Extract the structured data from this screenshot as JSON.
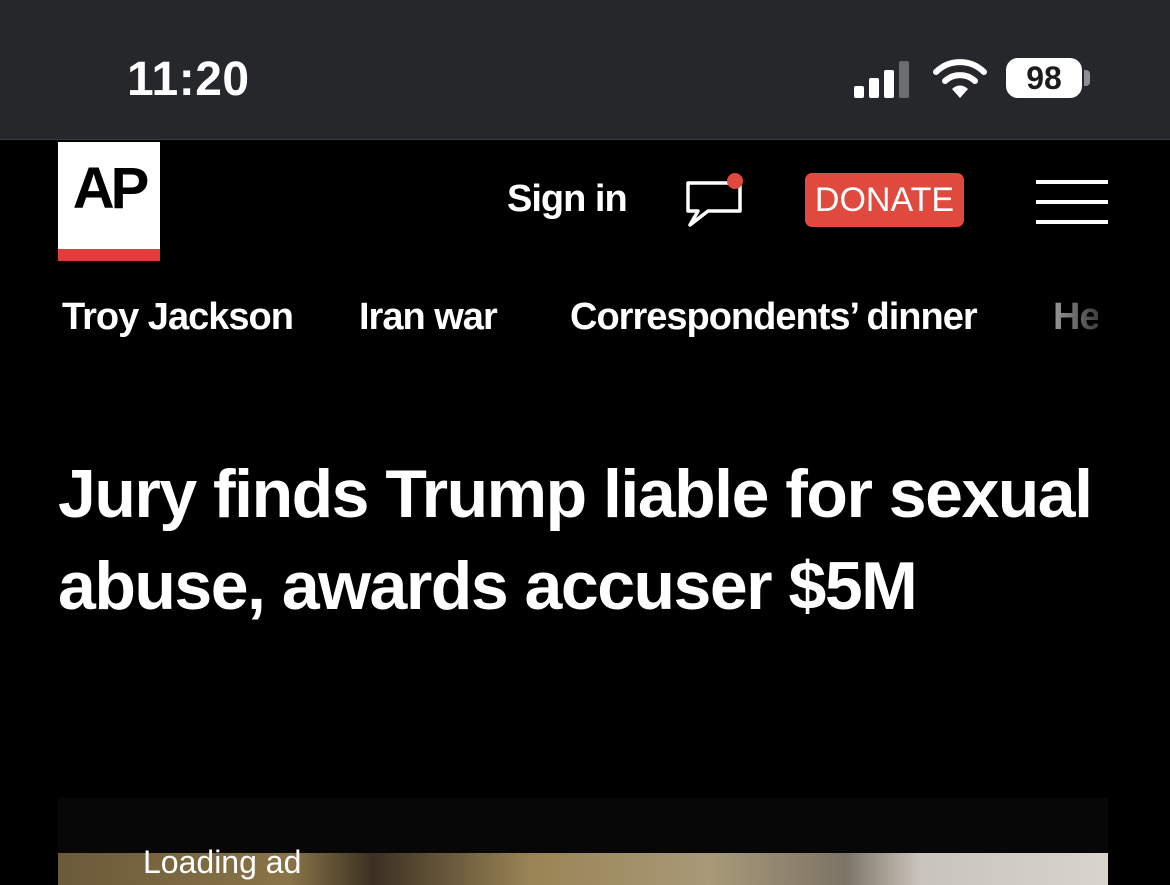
{
  "status_bar": {
    "time": "11:20",
    "battery": "98",
    "icons": [
      "signal-icon",
      "wifi-icon",
      "battery-icon"
    ]
  },
  "header": {
    "logo": "AP",
    "sign_in": "Sign in",
    "donate": "DONATE",
    "icons": [
      "comment-icon",
      "menu-icon"
    ],
    "colors": {
      "accent": "#e23d3a",
      "donate_bg": "#e0493d"
    }
  },
  "topics": [
    {
      "label": "Troy Jackson"
    },
    {
      "label": "Iran war"
    },
    {
      "label": "Correspondents’ dinner"
    },
    {
      "label": "He"
    }
  ],
  "article": {
    "headline": "Jury finds Trump liable for sexual abuse, awards accuser $5M"
  },
  "ad": {
    "loading_text": "Loading ad"
  }
}
